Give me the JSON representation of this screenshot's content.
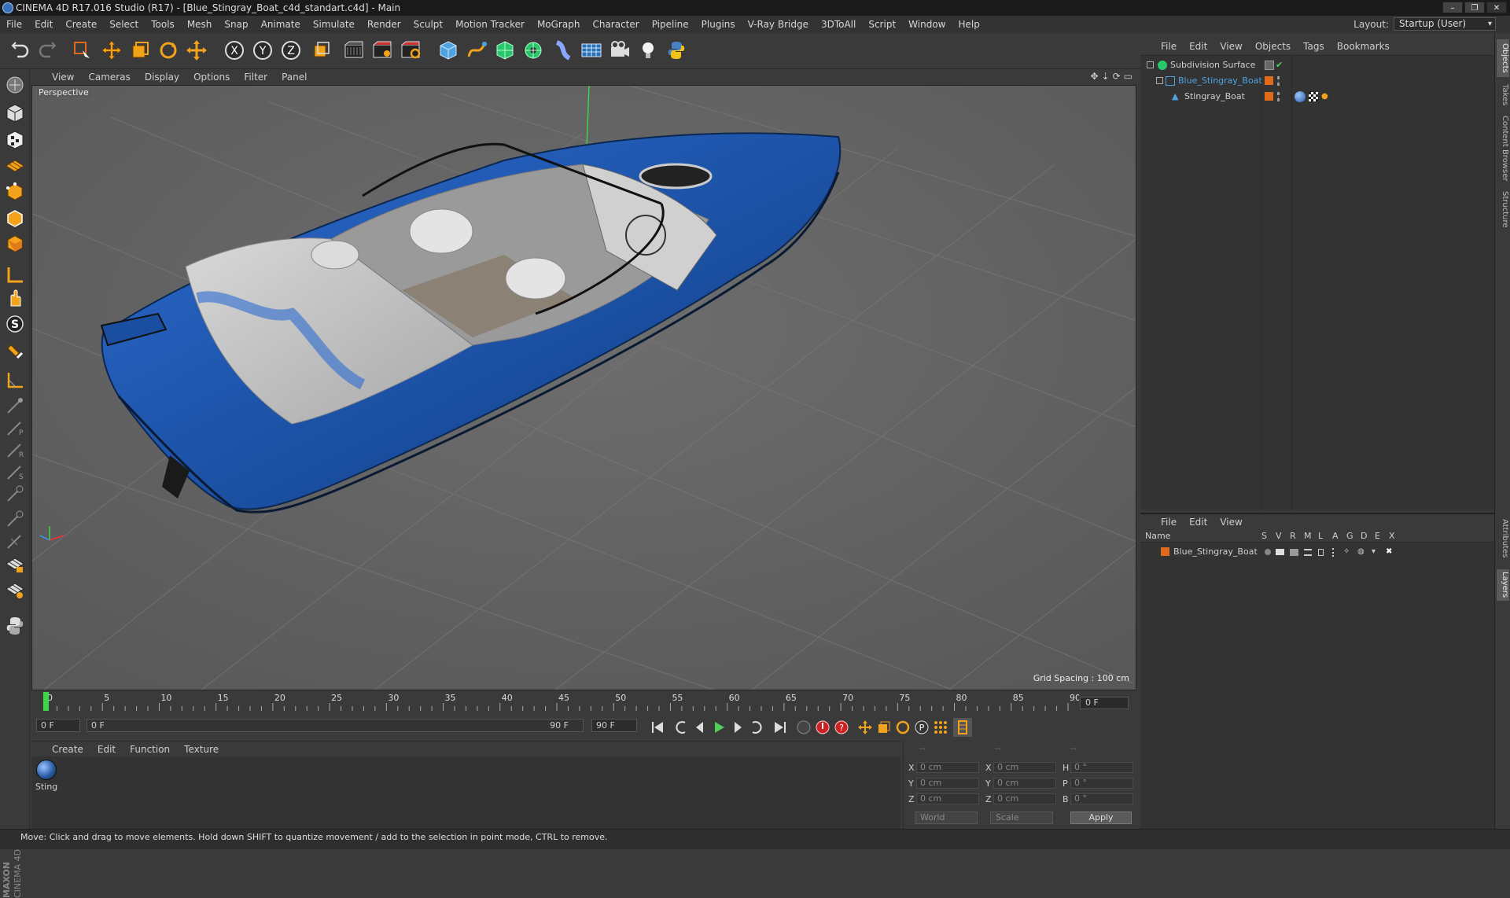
{
  "window": {
    "title": "CINEMA 4D R17.016 Studio (R17) - [Blue_Stingray_Boat_c4d_standart.c4d] - Main",
    "buttons": [
      "–",
      "❐",
      "✕"
    ]
  },
  "menubar": {
    "items": [
      "File",
      "Edit",
      "Create",
      "Select",
      "Tools",
      "Mesh",
      "Snap",
      "Animate",
      "Simulate",
      "Render",
      "Sculpt",
      "Motion Tracker",
      "MoGraph",
      "Character",
      "Pipeline",
      "Plugins",
      "V-Ray Bridge",
      "3DToAll",
      "Script",
      "Window",
      "Help"
    ],
    "layout_label": "Layout:",
    "layout_value": "Startup (User)"
  },
  "toolbar": {
    "icons": [
      "undo-icon",
      "redo-icon",
      "live-selection-icon",
      "move-icon",
      "scale-icon",
      "rotate-icon",
      "transform-icon",
      "x-axis-icon",
      "y-axis-icon",
      "z-axis-icon",
      "coordinate-system-icon",
      "render-view-icon",
      "render-picture-viewer-icon",
      "edit-render-settings-icon",
      "cube-icon",
      "spline-pen-icon",
      "subdivision-surface-icon",
      "array-icon",
      "deformer-icon",
      "floor-icon",
      "camera-icon",
      "light-icon",
      "python-icon"
    ],
    "axis_labels": [
      "X",
      "Y",
      "Z"
    ]
  },
  "lefttools": {
    "icons": [
      "make-editable-icon",
      "model-mode-icon",
      "texture-mode-icon",
      "workplane-icon",
      "points-mode-icon",
      "edges-mode-icon",
      "polygons-mode-icon",
      "axis-mode-icon",
      "tweak-icon",
      "solo-icon",
      "snap-icon",
      "quantize-icon",
      "brush-icon",
      "sculpt-pull-icon",
      "sculpt-smooth-icon",
      "sculpt-flatten-icon",
      "sculpt-inflate-icon",
      "sculpt-grab-icon",
      "sculpt-knife-icon",
      "lock-workplane-icon",
      "paint-icon",
      "python-script-icon"
    ],
    "brand_line1": "MAXON",
    "brand_line2": "CINEMA 4D"
  },
  "viewport": {
    "menu": [
      "View",
      "Cameras",
      "Display",
      "Options",
      "Filter",
      "Panel"
    ],
    "nav_icons": [
      "✥",
      "⇣",
      "⟳",
      "▭"
    ],
    "label": "Perspective",
    "grid_spacing": "Grid Spacing : 100 cm"
  },
  "timeline": {
    "ticks": [
      "0",
      "5",
      "10",
      "15",
      "20",
      "25",
      "30",
      "35",
      "40",
      "45",
      "50",
      "55",
      "60",
      "65",
      "70",
      "75",
      "80",
      "85",
      "90"
    ],
    "current_frame": "0 F"
  },
  "transport": {
    "start_field": "0 F",
    "range_start": "0 F",
    "range_end": "90 F",
    "end_field": "90 F"
  },
  "material_manager": {
    "menu": [
      "Create",
      "Edit",
      "Function",
      "Texture"
    ],
    "materials": [
      {
        "name": "Sting"
      }
    ]
  },
  "coordinates": {
    "headers": [
      "--",
      "--",
      "--"
    ],
    "rows": [
      {
        "a": "X",
        "av": "0 cm",
        "b": "X",
        "bv": "0 cm",
        "c": "H",
        "cv": "0 °"
      },
      {
        "a": "Y",
        "av": "0 cm",
        "b": "Y",
        "bv": "0 cm",
        "c": "P",
        "cv": "0 °"
      },
      {
        "a": "Z",
        "av": "0 cm",
        "b": "Z",
        "bv": "0 cm",
        "c": "B",
        "cv": "0 °"
      }
    ],
    "space": "World",
    "mode": "Scale",
    "apply": "Apply"
  },
  "object_manager": {
    "menu": [
      "File",
      "Edit",
      "View",
      "Objects",
      "Tags",
      "Bookmarks"
    ],
    "objects": [
      {
        "name": "Subdivision Surface"
      },
      {
        "name": "Blue_Stingray_Boat"
      },
      {
        "name": "Stingray_Boat"
      }
    ]
  },
  "layer_manager": {
    "menu": [
      "File",
      "Edit",
      "View"
    ],
    "headers": [
      "Name",
      "S",
      "V",
      "R",
      "M",
      "L",
      "A",
      "G",
      "D",
      "E",
      "X"
    ],
    "layers": [
      {
        "name": "Blue_Stingray_Boat",
        "color": "#e06a1c"
      }
    ]
  },
  "side_tabs": [
    "Objects",
    "Takes",
    "Content Browser",
    "Structure",
    "Attributes",
    "Layers"
  ],
  "status": {
    "text": "Move: Click and drag to move elements. Hold down SHIFT to quantize movement / add to the selection in point mode, CTRL to remove."
  },
  "colors": {
    "boat_blue": "#1e56b0",
    "accent_orange": "#e06a1c",
    "viewport_bg": "#646464"
  }
}
